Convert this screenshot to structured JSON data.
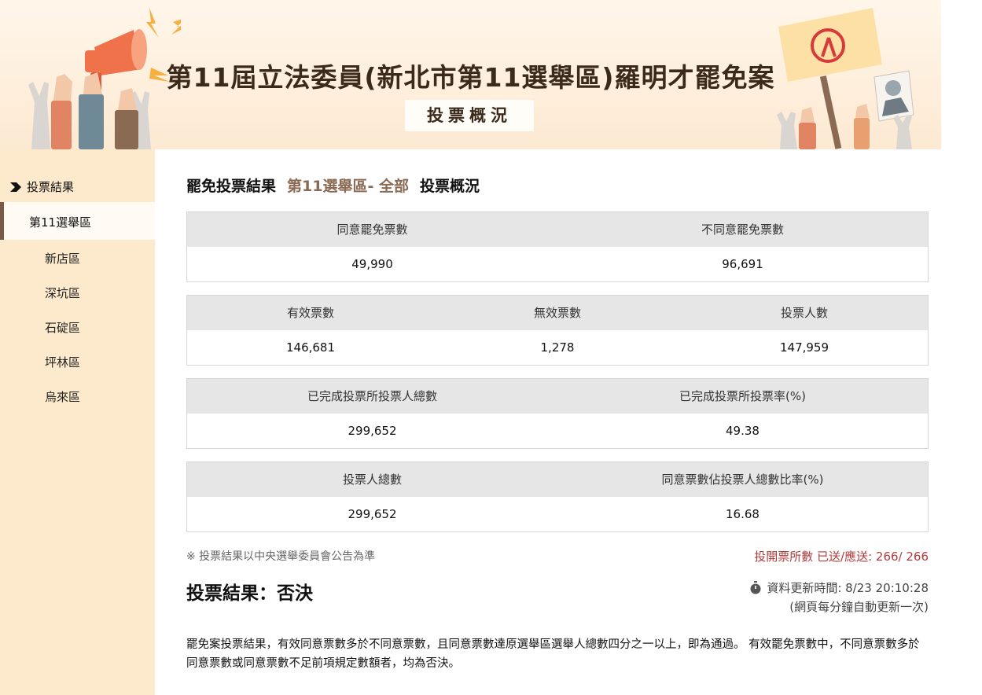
{
  "banner": {
    "title": "第11屆立法委員(新北市第11選舉區)羅明才罷免案",
    "subtitle": "投票概況"
  },
  "sidebar": {
    "heading": "投票結果",
    "active_item": "第11選舉區",
    "items": [
      "新店區",
      "深坑區",
      "石碇區",
      "坪林區",
      "烏來區"
    ]
  },
  "main": {
    "heading": "罷免投票結果",
    "district": "第11選舉區- 全部",
    "section": "投票概況",
    "tables": [
      {
        "headers": [
          "同意罷免票數",
          "不同意罷免票數"
        ],
        "values": [
          "49,990",
          "96,691"
        ]
      },
      {
        "headers": [
          "有效票數",
          "無效票數",
          "投票人數"
        ],
        "values": [
          "146,681",
          "1,278",
          "147,959"
        ]
      },
      {
        "headers": [
          "已完成投票所投票人總數",
          "已完成投票所投票率(%)"
        ],
        "values": [
          "299,652",
          "49.38"
        ]
      },
      {
        "headers": [
          "投票人總數",
          "同意票數佔投票人總數比率(%)"
        ],
        "values": [
          "299,652",
          "16.68"
        ]
      }
    ],
    "note": "※ 投票結果以中央選舉委員會公告為準",
    "stations": "投開票所數 已送/應送: 266/ 266",
    "result": "投票結果：否決",
    "update_time": "資料更新時間: 8/23 20:10:28",
    "update_note": "(網頁每分鐘自動更新一次)",
    "rule": "罷免案投票結果，有效同意票數多於不同意票數，且同意票數達原選舉區選舉人總數四分之一以上，即為通過。 有效罷免票數中，不同意票數多於同意票數或同意票數不足前項規定數額者，均為否決。"
  },
  "colors": {
    "banner_bg": "#fde9d2",
    "sidebar_bg": "#fde9cc",
    "accent_brown": "#8a6a52",
    "header_gray": "#e6e6e6",
    "alert_red": "#b23b3b"
  }
}
